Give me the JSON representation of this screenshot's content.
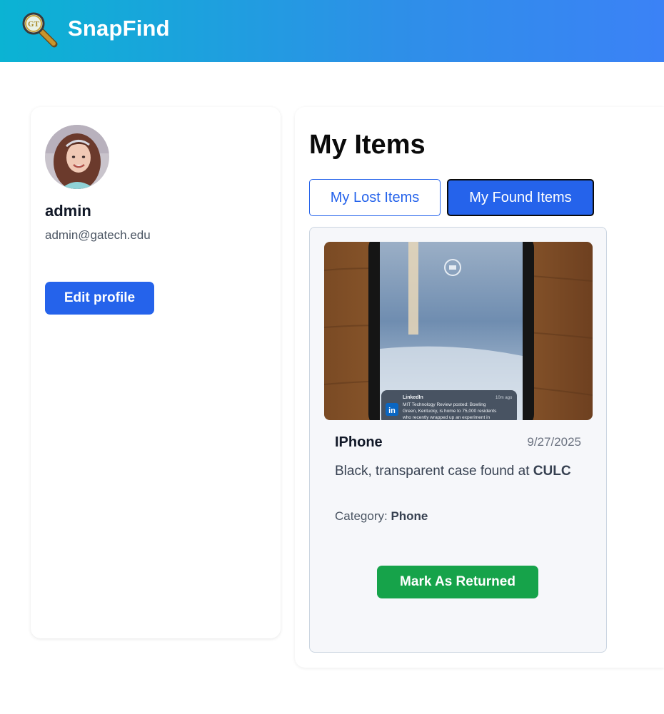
{
  "app": {
    "brand": "SnapFind",
    "logo_icon": "magnifying-glass-icon",
    "colors": {
      "header_start": "#0bb3d3",
      "header_end": "#3b82f6",
      "primary": "#2563eb",
      "success": "#16a34a"
    }
  },
  "profile": {
    "username": "admin",
    "email": "admin@gatech.edu",
    "edit_label": "Edit profile"
  },
  "items": {
    "title": "My Items",
    "tabs": [
      {
        "label": "My Lost Items",
        "active": false
      },
      {
        "label": "My Found Items",
        "active": true
      }
    ],
    "cards": [
      {
        "name": "IPhone",
        "date": "9/27/2025",
        "description_prefix": "Black, transparent case found at",
        "location": "CULC",
        "category_label": "Category:",
        "category": "Phone",
        "action_label": "Mark As Returned",
        "photo": {
          "notification_app": "LinkedIn",
          "notification_time": "10m ago",
          "notification_text": "MIT Technology Review posted: Bowling Green, Kentucky, is home to 75,000 residents who recently wrapped up an experiment in"
        }
      }
    ]
  }
}
